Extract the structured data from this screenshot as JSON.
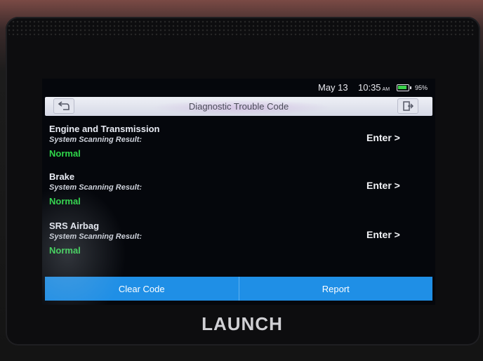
{
  "status_bar": {
    "date": "May 13",
    "time": "10:35",
    "ampm": "AM",
    "battery": "95%",
    "battery_level": 0.95
  },
  "header": {
    "title": "Diagnostic Trouble Code",
    "back_icon": "back-arrow-icon",
    "exit_icon": "exit-icon"
  },
  "systems": [
    {
      "name": "Engine and Transmission",
      "label": "System Scanning Result:",
      "status": "Normal",
      "action": "Enter >"
    },
    {
      "name": "Brake",
      "label": "System Scanning Result:",
      "status": "Normal",
      "action": "Enter >"
    },
    {
      "name": "SRS Airbag",
      "label": "System Scanning Result:",
      "status": "Normal",
      "action": "Enter >"
    }
  ],
  "buttons": {
    "clear": "Clear Code",
    "report": "Report"
  },
  "brand": "LAUNCH",
  "colors": {
    "status_normal": "#2fd64a",
    "button_blue": "#1f8fe6",
    "screen_bg": "#05070c"
  }
}
